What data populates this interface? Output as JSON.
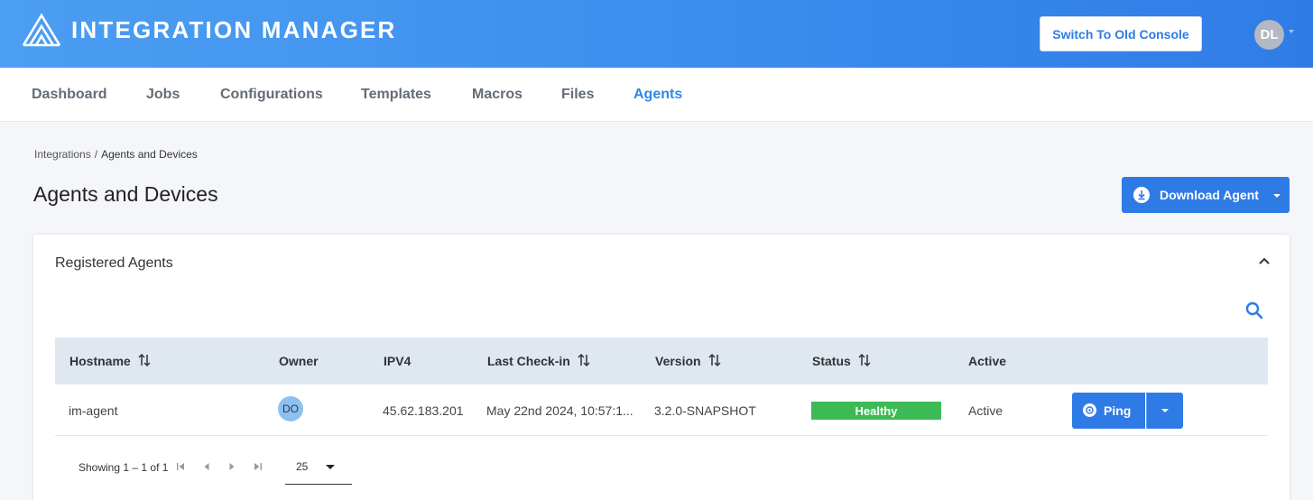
{
  "header": {
    "app_title": "INTEGRATION MANAGER",
    "logo_icon": "mountain-logo-icon",
    "switch_console_label": "Switch To Old Console",
    "user_initials": "DL",
    "accent_color": "#3d8fee"
  },
  "nav": {
    "items": [
      {
        "label": "Dashboard",
        "active": false
      },
      {
        "label": "Jobs",
        "active": false
      },
      {
        "label": "Configurations",
        "active": false
      },
      {
        "label": "Templates",
        "active": false
      },
      {
        "label": "Macros",
        "active": false
      },
      {
        "label": "Files",
        "active": false
      },
      {
        "label": "Agents",
        "active": true
      }
    ]
  },
  "breadcrumb": {
    "parent": "Integrations",
    "separator": "/",
    "current": "Agents and Devices"
  },
  "page": {
    "title": "Agents and Devices",
    "download_button_label": "Download Agent",
    "download_icon": "download-circle-icon"
  },
  "card": {
    "title": "Registered Agents",
    "collapse_icon": "chevron-up-icon",
    "search_icon": "search-icon"
  },
  "table": {
    "columns": [
      "Hostname",
      "Owner",
      "IPV4",
      "Last Check-in",
      "Version",
      "Status",
      "Active"
    ],
    "sortable": [
      true,
      false,
      false,
      true,
      true,
      true,
      false
    ],
    "rows": [
      {
        "hostname": "im-agent",
        "owner_initials": "DO",
        "ipv4": "45.62.183.201",
        "last_checkin": "May 22nd 2024, 10:57:1...",
        "version": "3.2.0-SNAPSHOT",
        "status": "Healthy",
        "status_color": "#3cba55",
        "active": "Active",
        "action_label": "Ping"
      }
    ]
  },
  "pagination": {
    "summary": "Showing 1 – 1 of 1",
    "page_size": "25"
  }
}
